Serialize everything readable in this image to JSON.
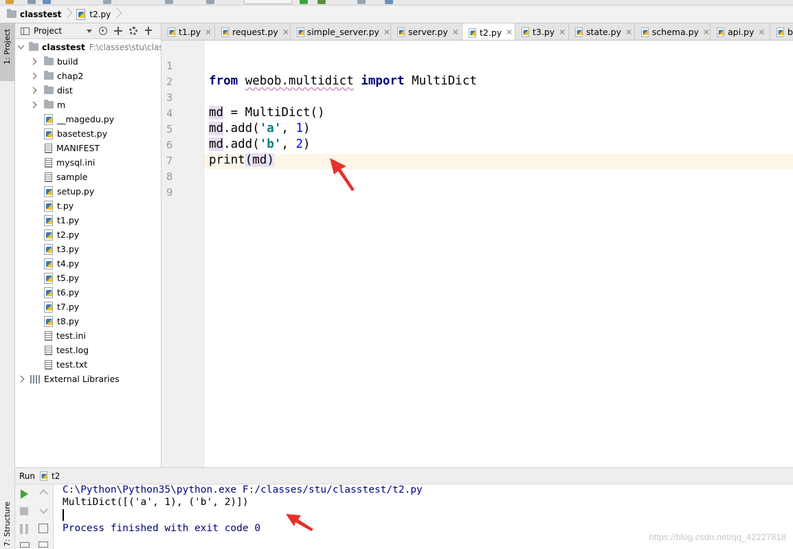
{
  "navbar": {
    "project_name": "classtest",
    "file_name": "t2.py"
  },
  "tool_windows": {
    "project_label": "1: Project",
    "structure_label": "7: Structure"
  },
  "project_panel": {
    "header_label": "Project",
    "root": {
      "name": "classtest",
      "path": "F:\\classes\\stu\\classtest"
    },
    "items": [
      {
        "label": "build",
        "type": "folder"
      },
      {
        "label": "chap2",
        "type": "folder"
      },
      {
        "label": "dist",
        "type": "folder"
      },
      {
        "label": "m",
        "type": "folder"
      },
      {
        "label": "__magedu.py",
        "type": "python"
      },
      {
        "label": "basetest.py",
        "type": "python"
      },
      {
        "label": "MANIFEST",
        "type": "text"
      },
      {
        "label": "mysql.ini",
        "type": "text"
      },
      {
        "label": "sample",
        "type": "text"
      },
      {
        "label": "setup.py",
        "type": "python"
      },
      {
        "label": "t.py",
        "type": "python"
      },
      {
        "label": "t1.py",
        "type": "python"
      },
      {
        "label": "t2.py",
        "type": "python"
      },
      {
        "label": "t3.py",
        "type": "python"
      },
      {
        "label": "t4.py",
        "type": "python"
      },
      {
        "label": "t5.py",
        "type": "python"
      },
      {
        "label": "t6.py",
        "type": "python"
      },
      {
        "label": "t7.py",
        "type": "python"
      },
      {
        "label": "t8.py",
        "type": "python"
      },
      {
        "label": "test.ini",
        "type": "text"
      },
      {
        "label": "test.log",
        "type": "text"
      },
      {
        "label": "test.txt",
        "type": "text"
      }
    ],
    "external_libraries": "External Libraries"
  },
  "tabs": [
    {
      "label": "t1.py"
    },
    {
      "label": "request.py"
    },
    {
      "label": "simple_server.py"
    },
    {
      "label": "server.py"
    },
    {
      "label": "t2.py",
      "active": true
    },
    {
      "label": "t3.py"
    },
    {
      "label": "state.py"
    },
    {
      "label": "schema.py"
    },
    {
      "label": "api.py"
    },
    {
      "label": "b"
    }
  ],
  "editor": {
    "line_numbers": [
      "1",
      "2",
      "3",
      "4",
      "5",
      "6",
      "7",
      "8",
      "9"
    ],
    "code": {
      "l2_from": "from",
      "l2_module": "webob.multidict",
      "l2_import": "import",
      "l2_name": "MultiDict",
      "l4_var": "md",
      "l4_rest": " = MultiDict()",
      "l5_var": "md",
      "l5_call": ".add(",
      "l5_key": "'a'",
      "l5_sep": ", ",
      "l5_num": "1",
      "l5_end": ")",
      "l6_var": "md",
      "l6_call": ".add(",
      "l6_key": "'b'",
      "l6_sep": ", ",
      "l6_num": "2",
      "l6_end": ")",
      "l7_func": "print",
      "l7_open": "(",
      "l7_arg": "md",
      "l7_close": ")"
    }
  },
  "run_panel": {
    "label": "Run",
    "config": "t2",
    "output": {
      "command": "C:\\Python\\Python35\\python.exe F:/classes/stu/classtest/t2.py",
      "result": "MultiDict([('a', 1), ('b', 2)])",
      "exit": "Process finished with exit code 0"
    }
  },
  "watermark": "https://blog.csdn.net/qq_42227818",
  "colors": {
    "keyword": "#000080",
    "string": "#008080",
    "number": "#0000ff",
    "annotation_arrow": "#e8302a"
  }
}
